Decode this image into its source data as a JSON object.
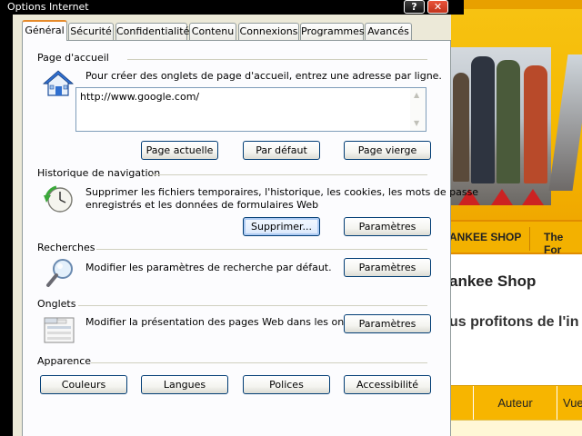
{
  "window": {
    "title": "Options Internet",
    "help_label": "?",
    "close_label": "✕"
  },
  "tabs": [
    {
      "label": "Général",
      "active": true
    },
    {
      "label": "Sécurité"
    },
    {
      "label": "Confidentialité"
    },
    {
      "label": "Contenu"
    },
    {
      "label": "Connexions"
    },
    {
      "label": "Programmes"
    },
    {
      "label": "Avancés"
    }
  ],
  "homepage": {
    "title": "Page d'accueil",
    "description": "Pour créer des onglets de page d'accueil, entrez une adresse par ligne.",
    "value": "http://www.google.com/",
    "icon": "home-icon",
    "buttons": {
      "current": "Page actuelle",
      "default": "Par défaut",
      "blank": "Page vierge"
    }
  },
  "history": {
    "title": "Historique de navigation",
    "description_line1": "Supprimer les fichiers temporaires, l'historique, les cookies, les mots de passe",
    "description_line2": "enregistrés et les données de formulaires Web",
    "icon": "history-clock-icon",
    "buttons": {
      "delete": "Supprimer...",
      "settings": "Paramètres"
    }
  },
  "search": {
    "title": "Recherches",
    "description": "Modifier les paramètres de recherche par défaut.",
    "icon": "magnifier-icon",
    "buttons": {
      "settings": "Paramètres"
    }
  },
  "tabs_group": {
    "title": "Onglets",
    "description": "Modifier la présentation des pages Web dans les onglets",
    "icon": "tabs-window-icon",
    "buttons": {
      "settings": "Paramètres"
    }
  },
  "appearance": {
    "title": "Apparence",
    "buttons": {
      "colors": "Couleurs",
      "languages": "Langues",
      "fonts": "Polices",
      "accessibility": "Accessibilité"
    }
  },
  "background_page": {
    "nav_items": [
      "ANKEE SHOP",
      "The For"
    ],
    "heading": "ankee Shop",
    "subheading": "us profitons de l'in",
    "table_headers": [
      "Auteur",
      "Vue"
    ],
    "colors": {
      "accent": "#f5b800",
      "nav": "#f3b100"
    }
  }
}
